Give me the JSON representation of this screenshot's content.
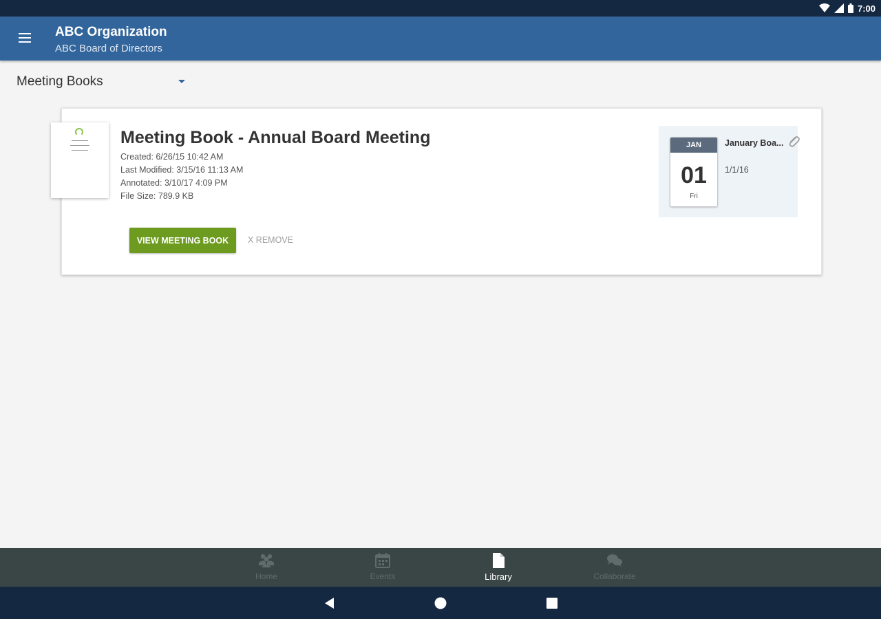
{
  "status_bar": {
    "time": "7:00"
  },
  "app_bar": {
    "title": "ABC Organization",
    "subtitle": "ABC Board of Directors"
  },
  "filter": {
    "selected": "Meeting Books"
  },
  "meeting_book": {
    "title": "Meeting Book - Annual Board Meeting",
    "created": "Created: 6/26/15 10:42 AM",
    "last_modified": "Last Modified: 3/15/16 11:13 AM",
    "annotated": "Annotated: 3/10/17 4:09 PM",
    "file_size": "File Size: 789.9 KB",
    "view_button": "VIEW MEETING BOOK",
    "remove_button": "X REMOVE"
  },
  "event": {
    "month": "JAN",
    "day": "01",
    "weekday": "Fri",
    "name": "January Boa...",
    "date": "1/1/16"
  },
  "bottom_nav": {
    "items": [
      {
        "label": "Home",
        "icon": "people-icon",
        "active": false
      },
      {
        "label": "Events",
        "icon": "calendar-icon",
        "active": false
      },
      {
        "label": "Library",
        "icon": "document-icon",
        "active": true
      },
      {
        "label": "Collaborate",
        "icon": "chat-icon",
        "active": false
      }
    ]
  },
  "colors": {
    "app_bar": "#32659b",
    "status_bar": "#152842",
    "view_button": "#6d9b1f",
    "bottom_nav": "#3a4645"
  }
}
